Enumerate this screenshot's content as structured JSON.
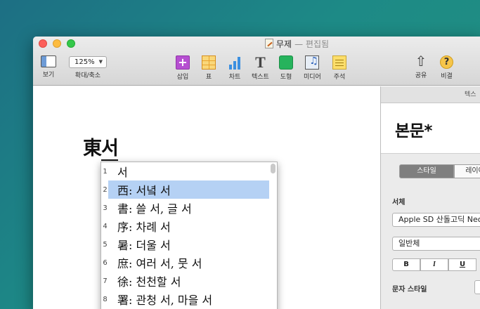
{
  "window": {
    "title": "무제",
    "title_suffix": "— 편집됨"
  },
  "toolbar": {
    "view_label": "보기",
    "zoom_value": "125%",
    "zoom_label": "확대/축소",
    "insert_label": "삽입",
    "table_label": "표",
    "chart_label": "차트",
    "text_label": "텍스트",
    "shape_label": "도형",
    "media_label": "미디어",
    "comment_label": "주석",
    "share_label": "공유",
    "help_label": "비결",
    "text_icon_glyph": "T",
    "insert_icon_glyph": "+",
    "share_icon_glyph": "⇧",
    "help_icon_glyph": "?"
  },
  "document": {
    "text_prefix": "東",
    "text_composing": "서"
  },
  "candidates": {
    "items": [
      {
        "num": "1",
        "text": "서"
      },
      {
        "num": "2",
        "text": "西: 서녘 서"
      },
      {
        "num": "3",
        "text": "書: 쓸 서, 글 서"
      },
      {
        "num": "4",
        "text": "序: 차례 서"
      },
      {
        "num": "5",
        "text": "暑: 더울 서"
      },
      {
        "num": "6",
        "text": "庶: 여러 서, 뭇 서"
      },
      {
        "num": "7",
        "text": "徐: 천천할 서"
      },
      {
        "num": "8",
        "text": "署: 관청 서, 마을 서"
      }
    ],
    "selected_index": 1
  },
  "inspector": {
    "tab_label": "텍스",
    "paragraph_style": "본문*",
    "seg_style": "스타일",
    "seg_layout": "레이아",
    "font_label": "서체",
    "font_family": "Apple SD 산돌고딕 Neo",
    "font_weight": "일반체",
    "bold_label": "B",
    "italic_label": "I",
    "underline_label": "U",
    "char_style_label": "문자 스타일"
  },
  "colors": {
    "selection": "#b5d1f4",
    "desktop": "#1d7a84"
  }
}
